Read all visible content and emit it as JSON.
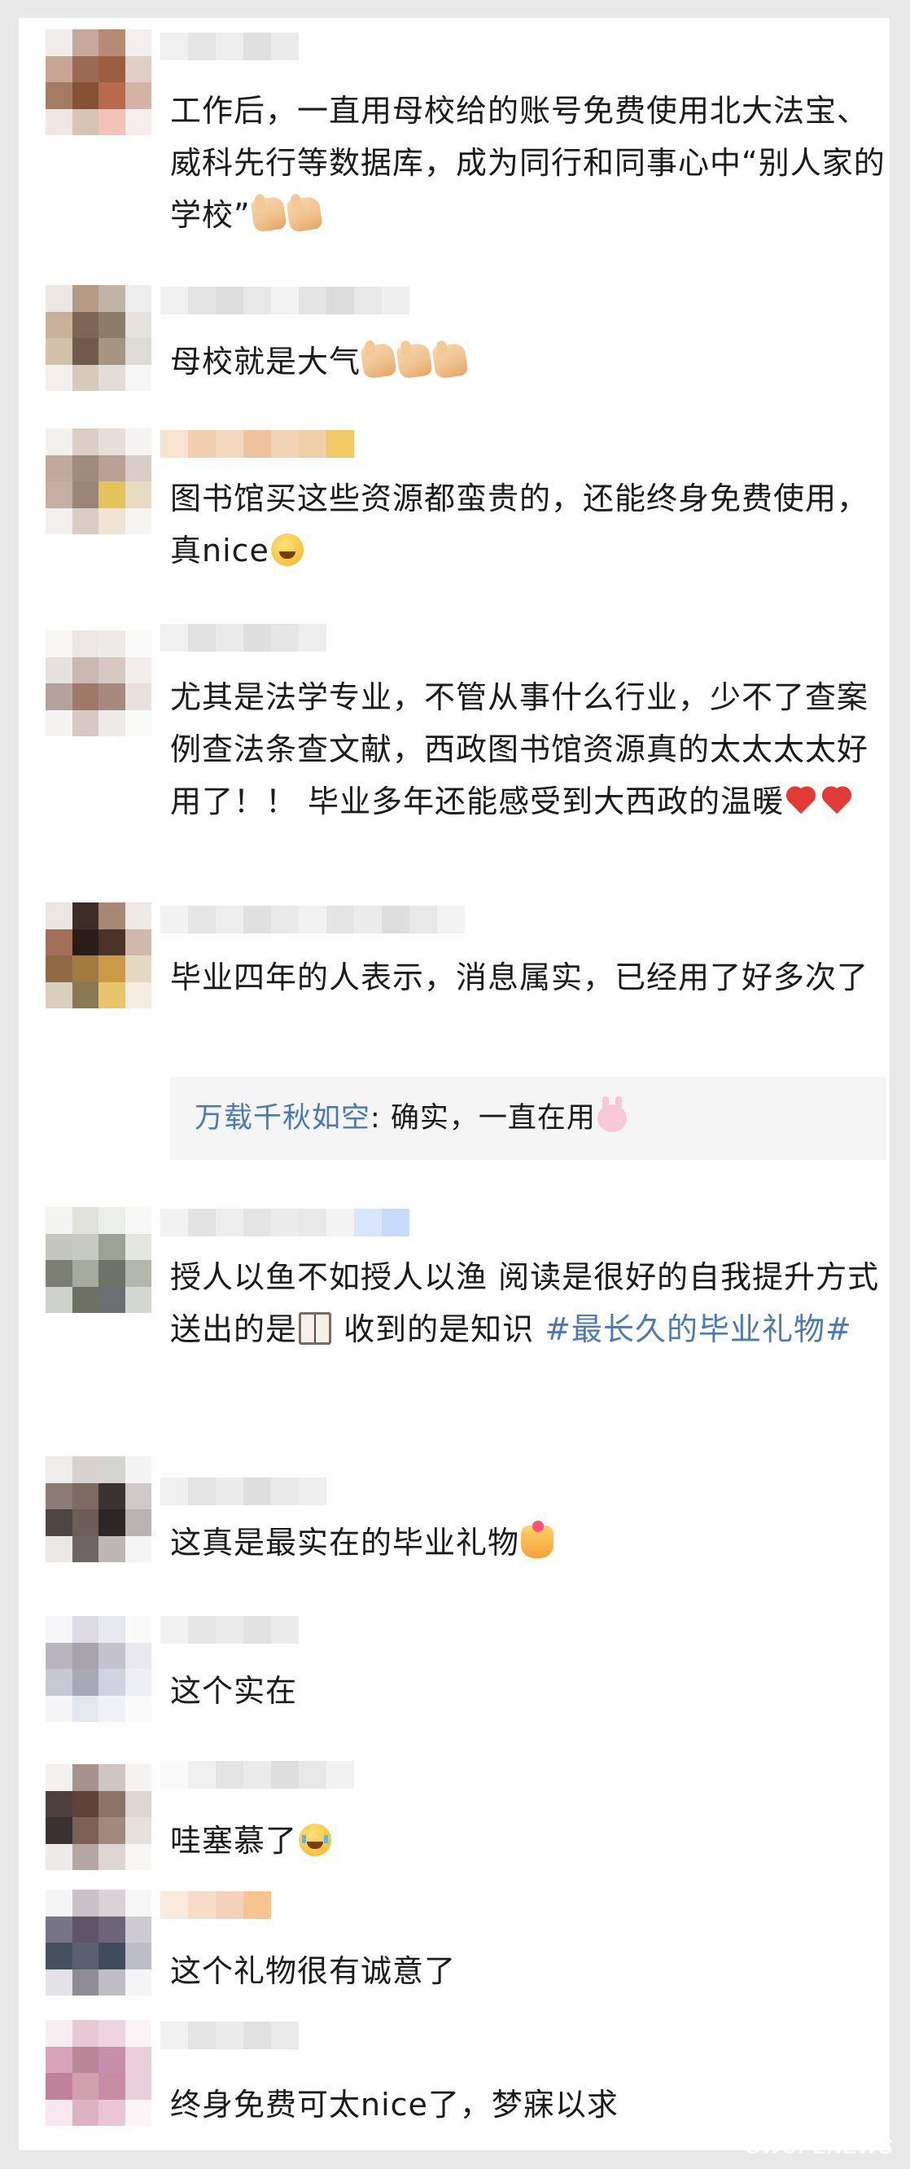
{
  "comments": [
    {
      "segments": [
        {
          "type": "text",
          "text": "工作后，一直用母校给的账号免费使用北大法宝、威科先行等数据库，成为同行和同事心中“别人家的学校”"
        },
        {
          "type": "emoji",
          "name": "thumbs-up-icon"
        },
        {
          "type": "emoji",
          "name": "thumbs-up-icon"
        }
      ]
    },
    {
      "segments": [
        {
          "type": "text",
          "text": "母校就是大气"
        },
        {
          "type": "emoji",
          "name": "thumbs-up-icon"
        },
        {
          "type": "emoji",
          "name": "thumbs-up-icon"
        },
        {
          "type": "emoji",
          "name": "thumbs-up-icon"
        }
      ]
    },
    {
      "segments": [
        {
          "type": "text",
          "text": "图书馆买这些资源都蛮贵的，还能终身免费使用，真nice"
        },
        {
          "type": "emoji",
          "name": "party-face-icon"
        }
      ]
    },
    {
      "segments": [
        {
          "type": "text",
          "text": "尤其是法学专业，不管从事什么行业，少不了查案例查法条查文献，西政图书馆资源真的太太太太好用了！！ 毕业多年还能感受到大西政的温暖"
        },
        {
          "type": "emoji",
          "name": "red-heart-icon"
        },
        {
          "type": "emoji",
          "name": "red-heart-icon"
        }
      ]
    },
    {
      "segments": [
        {
          "type": "text",
          "text": "毕业四年的人表示，消息属实，已经用了好多次了"
        }
      ],
      "reply": {
        "user": "万载千秋如空",
        "text": ": 确实，一直在用",
        "emoji": "bunny-face-icon"
      }
    },
    {
      "segments": [
        {
          "type": "text",
          "text": "授人以鱼不如授人以渔 阅读是很好的自我提升方式 送出的是"
        },
        {
          "type": "emoji",
          "name": "open-book-icon"
        },
        {
          "type": "text",
          "text": " 收到的是知识 "
        },
        {
          "type": "hashtag",
          "text": "#最长久的毕业礼物#"
        }
      ]
    },
    {
      "segments": [
        {
          "type": "text",
          "text": "这真是最实在的毕业礼物"
        },
        {
          "type": "emoji",
          "name": "heart-hands-icon"
        }
      ]
    },
    {
      "segments": [
        {
          "type": "text",
          "text": "这个实在"
        }
      ]
    },
    {
      "segments": [
        {
          "type": "text",
          "text": "哇塞慕了"
        },
        {
          "type": "emoji",
          "name": "crying-face-icon"
        }
      ]
    },
    {
      "segments": [
        {
          "type": "text",
          "text": "这个礼物很有诚意了"
        }
      ]
    },
    {
      "segments": [
        {
          "type": "text",
          "text": "终身免费可太nice了，梦寐以求"
        }
      ]
    }
  ],
  "watermark": "SWUPLNEWS",
  "colors": {
    "text": "#1b1b1b",
    "hashtag": "#4d7ab3",
    "reply_user": "#4d7ab3",
    "reply_background": "#f5f5f5",
    "page_background": "#e9e9e9"
  }
}
